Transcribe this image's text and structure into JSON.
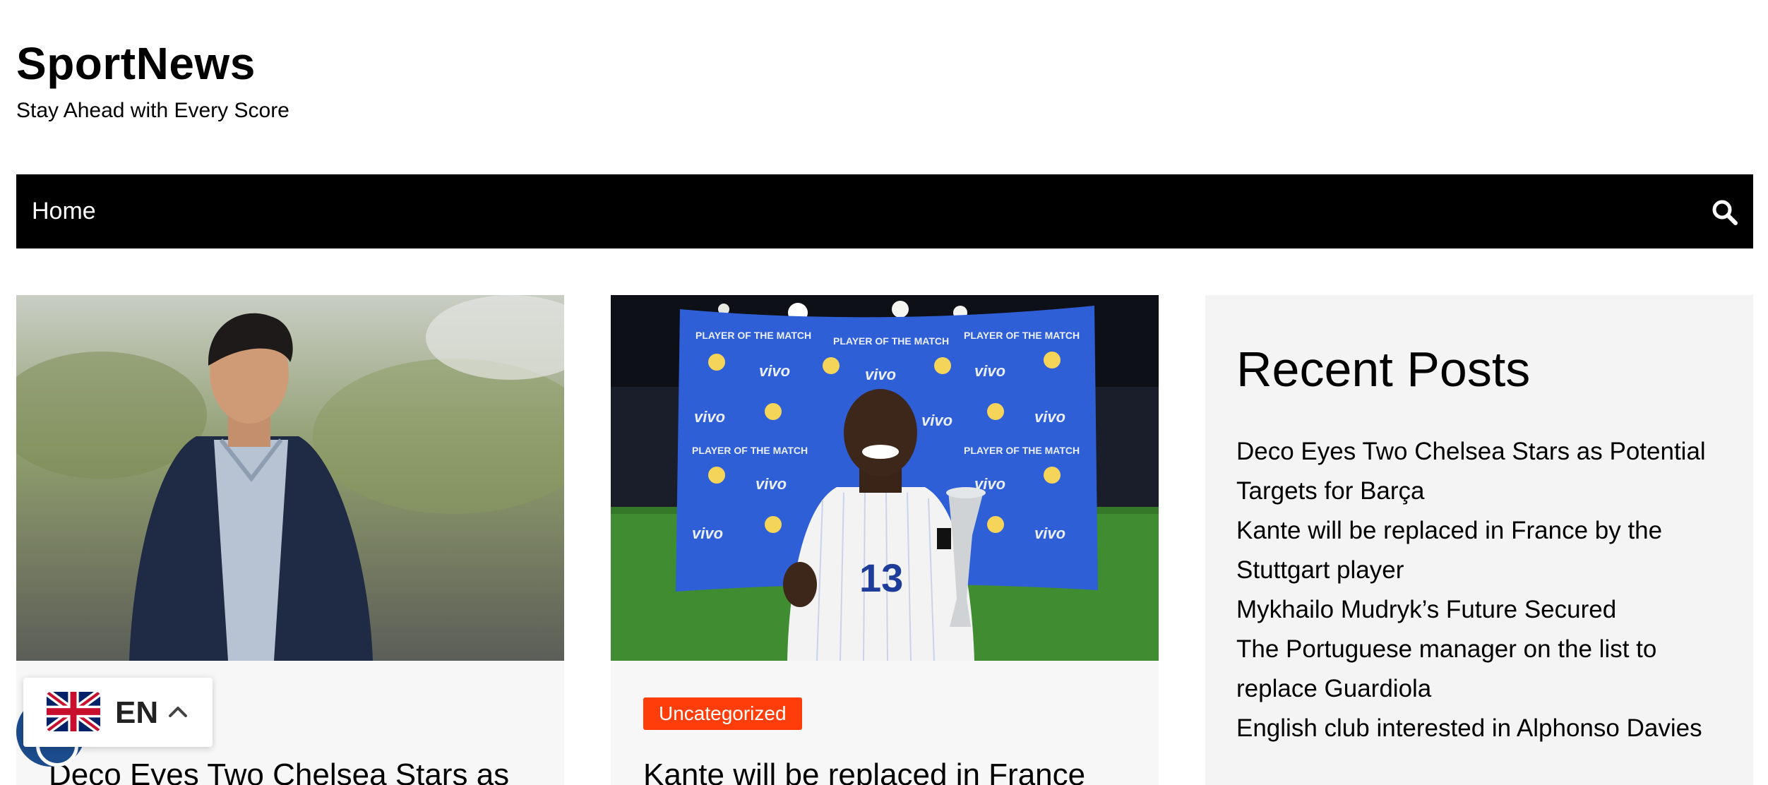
{
  "site": {
    "title": "SportNews",
    "tagline": "Stay Ahead with Every Score"
  },
  "nav": {
    "home_label": "Home",
    "search_icon": "search-icon"
  },
  "posts": [
    {
      "category": "",
      "title": "Deco Eyes Two Chelsea Stars as",
      "image": "man-in-navy-blazer-outdoor-photo"
    },
    {
      "category": "Uncategorized",
      "title": "Kante will be replaced in France",
      "image": "player-of-the-match-trophy-photo"
    }
  ],
  "sidebar": {
    "widget_title": "Recent Posts",
    "recent_posts": [
      {
        "line1": "Deco Eyes Two Chelsea Stars as Potential",
        "line2": "Targets for Barça"
      },
      {
        "line1": "Kante will be replaced in France by the",
        "line2": "Stuttgart player"
      },
      {
        "line1": "Mykhailo Mudryk’s Future Secured",
        "line2": ""
      },
      {
        "line1": "The Portuguese manager on the list to",
        "line2": "replace Guardiola"
      },
      {
        "line1": "English club interested in Alphonso Davies",
        "line2": ""
      }
    ]
  },
  "language": {
    "code": "EN",
    "flag_icon": "uk-flag-icon",
    "chevron_icon": "chevron-up-icon"
  },
  "colors": {
    "nav_bg": "#000000",
    "category_badge": "#ff3d0a",
    "sidebar_bg": "#f4f4f4",
    "a11y_button": "#1c4c8c"
  }
}
